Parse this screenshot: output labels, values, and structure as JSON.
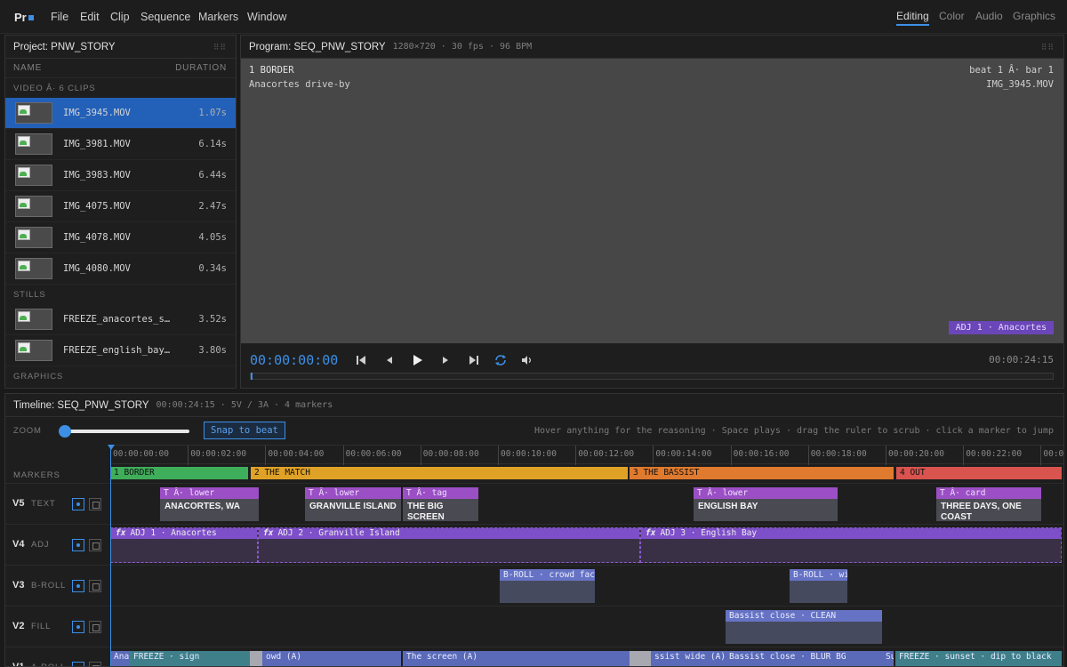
{
  "app": {
    "logo": "Pr"
  },
  "menu": [
    "File",
    "Edit",
    "Clip",
    "Sequence",
    "Markers",
    "Window"
  ],
  "workspaces": [
    "Editing",
    "Color",
    "Audio",
    "Graphics"
  ],
  "project": {
    "title": "Project: PNW_STORY",
    "col_name": "NAME",
    "col_duration": "DURATION",
    "video_section": "VIDEO Â· 6 CLIPS",
    "video_clips": [
      {
        "name": "IMG_3945.MOV",
        "duration": "1.07s"
      },
      {
        "name": "IMG_3981.MOV",
        "duration": "6.14s"
      },
      {
        "name": "IMG_3983.MOV",
        "duration": "6.44s"
      },
      {
        "name": "IMG_4075.MOV",
        "duration": "2.47s"
      },
      {
        "name": "IMG_4078.MOV",
        "duration": "4.05s"
      },
      {
        "name": "IMG_4080.MOV",
        "duration": "0.34s"
      }
    ],
    "stills_section": "STILLS",
    "stills": [
      {
        "name": "FREEZE_anacortes_s…",
        "duration": "3.52s"
      },
      {
        "name": "FREEZE_english_bay…",
        "duration": "3.80s"
      }
    ],
    "graphics_section": "GRAPHICS"
  },
  "program": {
    "title": "Program: SEQ_PNW_STORY",
    "meta": "1280×720 · 30 fps · 96 BPM",
    "overlay_marker": "1 BORDER",
    "overlay_desc": "Anacortes drive-by",
    "overlay_beat": "beat 1 Â· bar 1",
    "overlay_clip": "IMG_3945.MOV",
    "adj_badge": "ADJ 1 · Anacortes",
    "timecode": "00:00:00:00",
    "duration": "00:00:24:15",
    "playhead_fraction": 0
  },
  "timeline": {
    "title": "Timeline: SEQ_PNW_STORY",
    "meta": "00:00:24:15 · 5V / 3A · 4 markers",
    "zoom_label": "ZOOM",
    "zoom_level": 0,
    "snap_label": "Snap to beat",
    "hint": "Hover anything for the reasoning · Space plays · drag the ruler to scrub · click a marker to jump",
    "ruler": [
      "00:00:00:00",
      "00:00:02:00",
      "00:00:04:00",
      "00:00:06:00",
      "00:00:08:00",
      "00:00:10:00",
      "00:00:12:00",
      "00:00:14:00",
      "00:00:16:00",
      "00:00:18:00",
      "00:00:20:00",
      "00:00:22:00",
      "00:0"
    ],
    "markers_label": "MARKERS",
    "markers": [
      "1 BORDER",
      "2 THE MATCH",
      "3 THE BASSIST",
      "4 OUT"
    ],
    "marker_colors": [
      "#3fae5a",
      "#e0a226",
      "#e07a2e",
      "#d9534f"
    ],
    "tracks": [
      {
        "name": "V5",
        "type": "TEXT"
      },
      {
        "name": "V4",
        "type": "ADJ"
      },
      {
        "name": "V3",
        "type": "B-ROLL"
      },
      {
        "name": "V2",
        "type": "FILL"
      },
      {
        "name": "V1",
        "type": "A-ROLL"
      }
    ],
    "text_clips": [
      {
        "tag": "T Â· lower",
        "text": "ANACORTES, WA"
      },
      {
        "tag": "T Â· lower",
        "text": "GRANVILLE ISLAND"
      },
      {
        "tag": "T Â· tag",
        "text": "THE BIG SCREEN"
      },
      {
        "tag": "T Â· lower",
        "text": "ENGLISH BAY"
      },
      {
        "tag": "T Â· card",
        "text": "THREE DAYS, ONE COAST"
      }
    ],
    "adj_clips": [
      {
        "fx": "fx",
        "label": "ADJ 1 · Anacortes"
      },
      {
        "fx": "fx",
        "label": "ADJ 2 · Granville Island"
      },
      {
        "fx": "fx",
        "label": "ADJ 3 · English Bay"
      }
    ],
    "broll_clips": [
      "B-ROLL · crowd face",
      "B-ROLL · wi"
    ],
    "fill_clips": [
      "Bassist close · CLEAN"
    ],
    "aroll_clips": [
      "Ana",
      "FREEZE · sign",
      "owd (A)",
      "The screen (A)",
      "ssist wide (A)",
      "Bassist close · BLUR BG",
      "Su",
      "FREEZE · sunset · dip to black"
    ]
  }
}
